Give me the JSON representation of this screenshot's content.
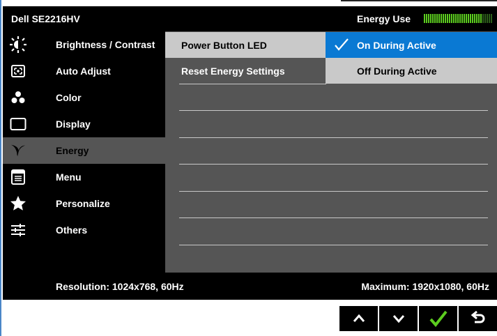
{
  "osd": {
    "model": "Dell SE2216HV",
    "energy_use_label": "Energy Use",
    "energy_use_level": 0.85,
    "menu": [
      {
        "label": "Brightness / Contrast",
        "icon": "brightness-icon"
      },
      {
        "label": "Auto Adjust",
        "icon": "auto-adjust-icon"
      },
      {
        "label": "Color",
        "icon": "color-icon"
      },
      {
        "label": "Display",
        "icon": "display-icon"
      },
      {
        "label": "Energy",
        "icon": "energy-leaf-icon",
        "active": true
      },
      {
        "label": "Menu",
        "icon": "menu-icon"
      },
      {
        "label": "Personalize",
        "icon": "star-icon"
      },
      {
        "label": "Others",
        "icon": "sliders-icon"
      }
    ],
    "submenu": [
      {
        "label": "Power Button LED",
        "selected": true
      },
      {
        "label": "Reset Energy Settings",
        "selected": false
      }
    ],
    "options": [
      {
        "label": "On During Active",
        "selected": true
      },
      {
        "label": "Off During Active",
        "selected": false
      }
    ],
    "footer": {
      "resolution": "Resolution: 1024x768, 60Hz",
      "maximum": "Maximum: 1920x1080, 60Hz"
    }
  },
  "buttons": [
    {
      "name": "up-button",
      "icon": "chevron-up-icon"
    },
    {
      "name": "down-button",
      "icon": "chevron-down-icon"
    },
    {
      "name": "ok-button",
      "icon": "check-icon"
    },
    {
      "name": "back-button",
      "icon": "back-arrow-icon"
    }
  ],
  "colors": {
    "highlight": "#0a79d3",
    "energy_green": "#5ccc1f",
    "panel": "#555555"
  }
}
